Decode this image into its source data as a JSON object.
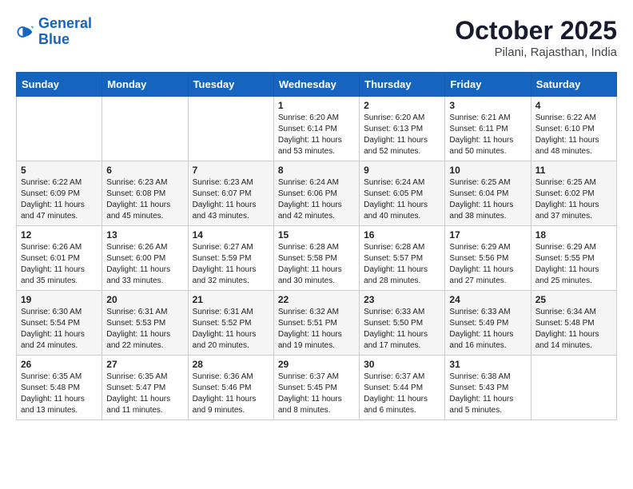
{
  "header": {
    "logo_line1": "General",
    "logo_line2": "Blue",
    "month": "October 2025",
    "location": "Pilani, Rajasthan, India"
  },
  "days_of_week": [
    "Sunday",
    "Monday",
    "Tuesday",
    "Wednesday",
    "Thursday",
    "Friday",
    "Saturday"
  ],
  "weeks": [
    [
      {
        "day": "",
        "info": ""
      },
      {
        "day": "",
        "info": ""
      },
      {
        "day": "",
        "info": ""
      },
      {
        "day": "1",
        "info": "Sunrise: 6:20 AM\nSunset: 6:14 PM\nDaylight: 11 hours\nand 53 minutes."
      },
      {
        "day": "2",
        "info": "Sunrise: 6:20 AM\nSunset: 6:13 PM\nDaylight: 11 hours\nand 52 minutes."
      },
      {
        "day": "3",
        "info": "Sunrise: 6:21 AM\nSunset: 6:11 PM\nDaylight: 11 hours\nand 50 minutes."
      },
      {
        "day": "4",
        "info": "Sunrise: 6:22 AM\nSunset: 6:10 PM\nDaylight: 11 hours\nand 48 minutes."
      }
    ],
    [
      {
        "day": "5",
        "info": "Sunrise: 6:22 AM\nSunset: 6:09 PM\nDaylight: 11 hours\nand 47 minutes."
      },
      {
        "day": "6",
        "info": "Sunrise: 6:23 AM\nSunset: 6:08 PM\nDaylight: 11 hours\nand 45 minutes."
      },
      {
        "day": "7",
        "info": "Sunrise: 6:23 AM\nSunset: 6:07 PM\nDaylight: 11 hours\nand 43 minutes."
      },
      {
        "day": "8",
        "info": "Sunrise: 6:24 AM\nSunset: 6:06 PM\nDaylight: 11 hours\nand 42 minutes."
      },
      {
        "day": "9",
        "info": "Sunrise: 6:24 AM\nSunset: 6:05 PM\nDaylight: 11 hours\nand 40 minutes."
      },
      {
        "day": "10",
        "info": "Sunrise: 6:25 AM\nSunset: 6:04 PM\nDaylight: 11 hours\nand 38 minutes."
      },
      {
        "day": "11",
        "info": "Sunrise: 6:25 AM\nSunset: 6:02 PM\nDaylight: 11 hours\nand 37 minutes."
      }
    ],
    [
      {
        "day": "12",
        "info": "Sunrise: 6:26 AM\nSunset: 6:01 PM\nDaylight: 11 hours\nand 35 minutes."
      },
      {
        "day": "13",
        "info": "Sunrise: 6:26 AM\nSunset: 6:00 PM\nDaylight: 11 hours\nand 33 minutes."
      },
      {
        "day": "14",
        "info": "Sunrise: 6:27 AM\nSunset: 5:59 PM\nDaylight: 11 hours\nand 32 minutes."
      },
      {
        "day": "15",
        "info": "Sunrise: 6:28 AM\nSunset: 5:58 PM\nDaylight: 11 hours\nand 30 minutes."
      },
      {
        "day": "16",
        "info": "Sunrise: 6:28 AM\nSunset: 5:57 PM\nDaylight: 11 hours\nand 28 minutes."
      },
      {
        "day": "17",
        "info": "Sunrise: 6:29 AM\nSunset: 5:56 PM\nDaylight: 11 hours\nand 27 minutes."
      },
      {
        "day": "18",
        "info": "Sunrise: 6:29 AM\nSunset: 5:55 PM\nDaylight: 11 hours\nand 25 minutes."
      }
    ],
    [
      {
        "day": "19",
        "info": "Sunrise: 6:30 AM\nSunset: 5:54 PM\nDaylight: 11 hours\nand 24 minutes."
      },
      {
        "day": "20",
        "info": "Sunrise: 6:31 AM\nSunset: 5:53 PM\nDaylight: 11 hours\nand 22 minutes."
      },
      {
        "day": "21",
        "info": "Sunrise: 6:31 AM\nSunset: 5:52 PM\nDaylight: 11 hours\nand 20 minutes."
      },
      {
        "day": "22",
        "info": "Sunrise: 6:32 AM\nSunset: 5:51 PM\nDaylight: 11 hours\nand 19 minutes."
      },
      {
        "day": "23",
        "info": "Sunrise: 6:33 AM\nSunset: 5:50 PM\nDaylight: 11 hours\nand 17 minutes."
      },
      {
        "day": "24",
        "info": "Sunrise: 6:33 AM\nSunset: 5:49 PM\nDaylight: 11 hours\nand 16 minutes."
      },
      {
        "day": "25",
        "info": "Sunrise: 6:34 AM\nSunset: 5:48 PM\nDaylight: 11 hours\nand 14 minutes."
      }
    ],
    [
      {
        "day": "26",
        "info": "Sunrise: 6:35 AM\nSunset: 5:48 PM\nDaylight: 11 hours\nand 13 minutes."
      },
      {
        "day": "27",
        "info": "Sunrise: 6:35 AM\nSunset: 5:47 PM\nDaylight: 11 hours\nand 11 minutes."
      },
      {
        "day": "28",
        "info": "Sunrise: 6:36 AM\nSunset: 5:46 PM\nDaylight: 11 hours\nand 9 minutes."
      },
      {
        "day": "29",
        "info": "Sunrise: 6:37 AM\nSunset: 5:45 PM\nDaylight: 11 hours\nand 8 minutes."
      },
      {
        "day": "30",
        "info": "Sunrise: 6:37 AM\nSunset: 5:44 PM\nDaylight: 11 hours\nand 6 minutes."
      },
      {
        "day": "31",
        "info": "Sunrise: 6:38 AM\nSunset: 5:43 PM\nDaylight: 11 hours\nand 5 minutes."
      },
      {
        "day": "",
        "info": ""
      }
    ]
  ]
}
